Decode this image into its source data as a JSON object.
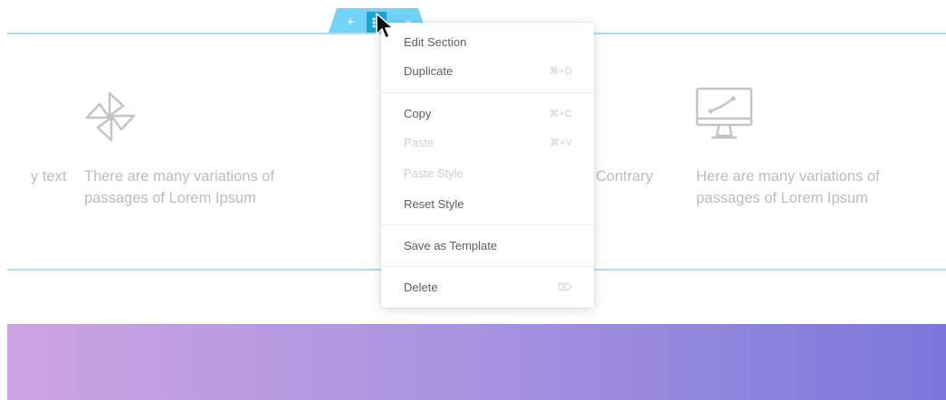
{
  "section_handle": {
    "add_symbol": "+",
    "close_symbol": "×"
  },
  "features": [
    {
      "text": "y text"
    },
    {
      "line1": "There are many variations of",
      "line2": "passages of Lorem Ipsum",
      "icon": "pinwheel-icon"
    },
    {
      "text": "Contrary"
    },
    {
      "line1": "Here are many variations of",
      "line2": "passages of Lorem Ipsum",
      "icon": "monitor-chart-icon"
    }
  ],
  "context_menu": {
    "items": [
      {
        "label": "Edit Section",
        "shortcut": "",
        "disabled": false
      },
      {
        "label": "Duplicate",
        "shortcut": "⌘+D",
        "disabled": false
      },
      {
        "label": "Copy",
        "shortcut": "⌘+C",
        "disabled": false
      },
      {
        "label": "Paste",
        "shortcut": "⌘+V",
        "disabled": true
      },
      {
        "label": "Paste Style",
        "shortcut": "",
        "disabled": true
      },
      {
        "label": "Reset Style",
        "shortcut": "",
        "disabled": false
      },
      {
        "label": "Save as Template",
        "shortcut": "",
        "disabled": false
      },
      {
        "label": "Delete",
        "shortcut": "⌦",
        "disabled": false
      }
    ]
  },
  "colors": {
    "section_line": "#a9e0f6",
    "handle": "#71d4f7",
    "handle_active": "#1ea2d6",
    "gradient_start": "#cda3e3",
    "gradient_end": "#7b77db"
  }
}
